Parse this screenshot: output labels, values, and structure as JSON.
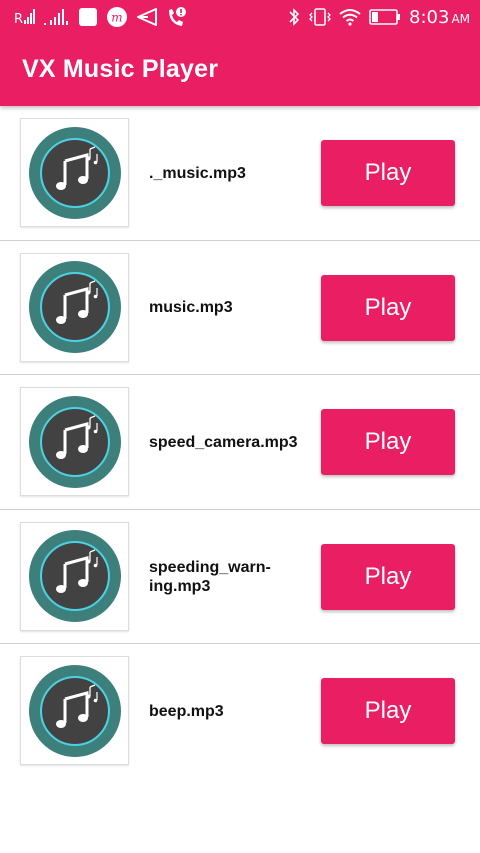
{
  "status_bar": {
    "time": "8:03",
    "ampm": "AM",
    "left_icons": [
      "signal-1-icon",
      "signal-2-icon",
      "notification-square-icon",
      "m-app-icon",
      "send-icon",
      "missed-call-icon"
    ],
    "right_icons": [
      "bluetooth-icon",
      "vibrate-icon",
      "wifi-icon",
      "battery-icon"
    ]
  },
  "app_bar": {
    "title": "VX Music Player"
  },
  "colors": {
    "primary": "#e91e63",
    "disc_outer": "#3d7f7a",
    "disc_inner": "#424242",
    "disc_ring": "#4dd0e1"
  },
  "tracks": [
    {
      "name": "._music.mp3",
      "button_label": "Play",
      "icon": "music-note-icon"
    },
    {
      "name": "music.mp3",
      "button_label": "Play",
      "icon": "music-note-icon"
    },
    {
      "name": "speed_camera.mp3",
      "button_label": "Play",
      "icon": "music-note-icon"
    },
    {
      "name": "speeding_warn-ing.mp3",
      "button_label": "Play",
      "icon": "music-note-icon"
    },
    {
      "name": "beep.mp3",
      "button_label": "Play",
      "icon": "music-note-icon"
    }
  ]
}
